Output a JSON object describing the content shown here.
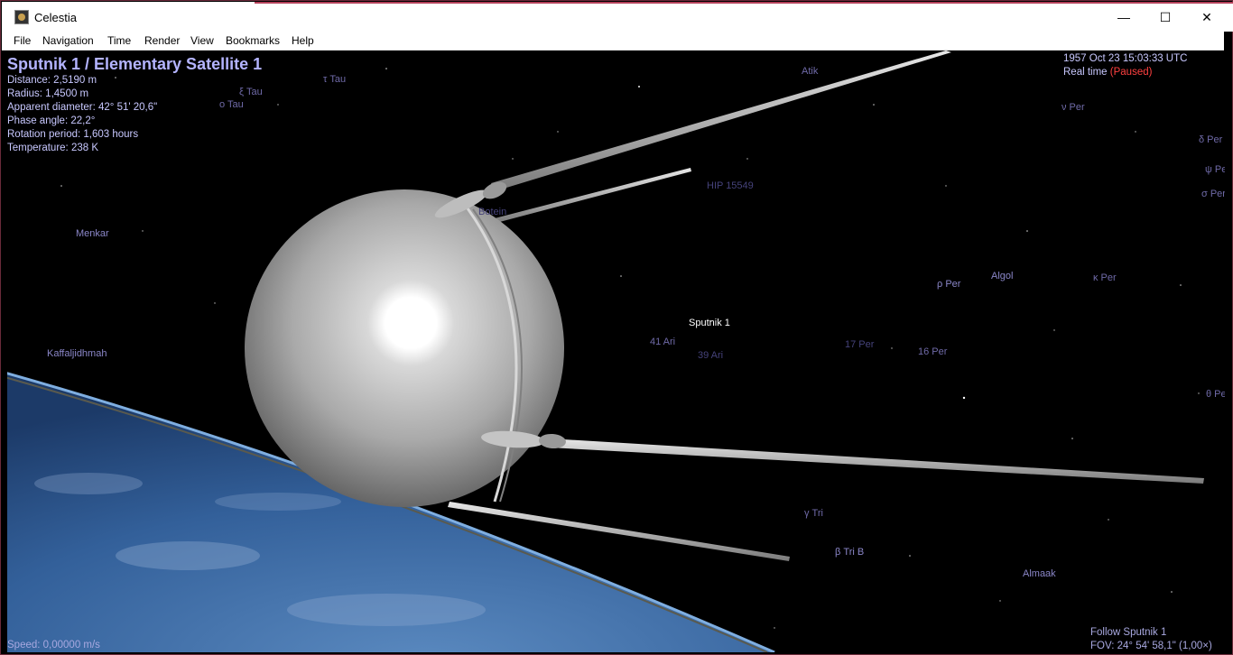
{
  "window": {
    "title": "Celestia",
    "min_glyph": "—",
    "max_glyph": "☐",
    "close_glyph": "✕"
  },
  "menu": {
    "file": "File",
    "navigation": "Navigation",
    "time": "Time",
    "render": "Render",
    "view": "View",
    "bookmarks": "Bookmarks",
    "help": "Help"
  },
  "info": {
    "title": "Sputnik 1 / Elementary Satellite 1",
    "distance": "Distance: 2,5190 m",
    "radius": "Radius: 1,4500 m",
    "apparent_diameter": "Apparent diameter: 42° 51' 20,6\"",
    "phase_angle": "Phase angle: 22,2°",
    "rotation_period": "Rotation period: 1,603 hours",
    "temperature": "Temperature: 238 K"
  },
  "time": {
    "datetime": "1957 Oct 23 15:03:33 UTC",
    "mode": "Real time",
    "status": "(Paused)"
  },
  "footer": {
    "speed": "Speed: 0,00000 m/s",
    "follow": "Follow Sputnik 1",
    "fov": "FOV: 24° 54' 58,1\" (1,00×)"
  },
  "object_label": "Sputnik 1",
  "stars": {
    "t_tau": "τ Tau",
    "xi_tau": "ξ Tau",
    "o_tau": "o Tau",
    "atik": "Atik",
    "nu_per": "ν Per",
    "delta_per": "δ Per",
    "psi_per": "ψ Per",
    "sigma_per": "σ Per",
    "hip": "HIP 15549",
    "botein": "Botein",
    "menkar": "Menkar",
    "rho_per": "ρ Per",
    "algol": "Algol",
    "kappa_per": "κ Per",
    "kaffaljidhmah": "Kaffaljidhmah",
    "ari41": "41 Ari",
    "ari39": "39 Ari",
    "per17": "17 Per",
    "per16": "16 Per",
    "theta_per": "θ Per",
    "gamma_tri": "γ Tri",
    "beta_tri": "β Tri B",
    "almaak": "Almaak"
  },
  "colors": {
    "hud_text": "#c8c8ff",
    "paused": "#ff4040",
    "star_label": "#6f6aa8",
    "earth": "#3a6aa8"
  }
}
